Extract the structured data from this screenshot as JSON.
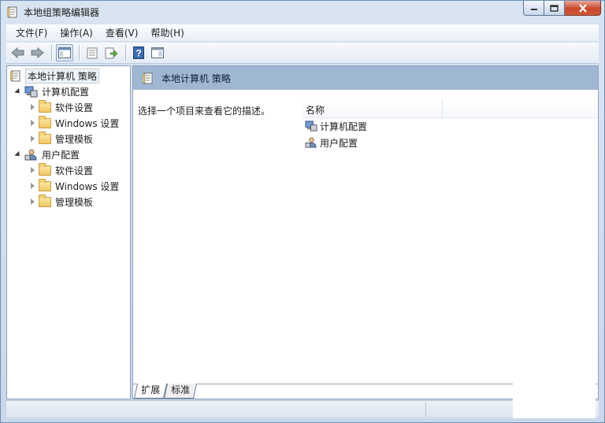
{
  "window": {
    "title": "本地组策略编辑器"
  },
  "menu": [
    "文件(F)",
    "操作(A)",
    "查看(V)",
    "帮助(H)"
  ],
  "toolbar": {
    "buttons": [
      "back-icon",
      "forward-icon",
      "show-tree-icon",
      "properties-icon",
      "export-list-icon",
      "help-icon",
      "show-action-pane-icon"
    ]
  },
  "tree": {
    "root": "本地计算机 策略",
    "computer": {
      "label": "计算机配置",
      "children": [
        "软件设置",
        "Windows 设置",
        "管理模板"
      ]
    },
    "user": {
      "label": "用户配置",
      "children": [
        "软件设置",
        "Windows 设置",
        "管理模板"
      ]
    }
  },
  "detail": {
    "header": "本地计算机 策略",
    "description": "选择一个项目来查看它的描述。",
    "column_name": "名称",
    "items": [
      "计算机配置",
      "用户配置"
    ]
  },
  "tabs": [
    "扩展",
    "标准"
  ],
  "colors": {
    "header_bar": "#9fb7d3",
    "window_frame": "#6f8fb3",
    "close_button": "#c9462c"
  }
}
